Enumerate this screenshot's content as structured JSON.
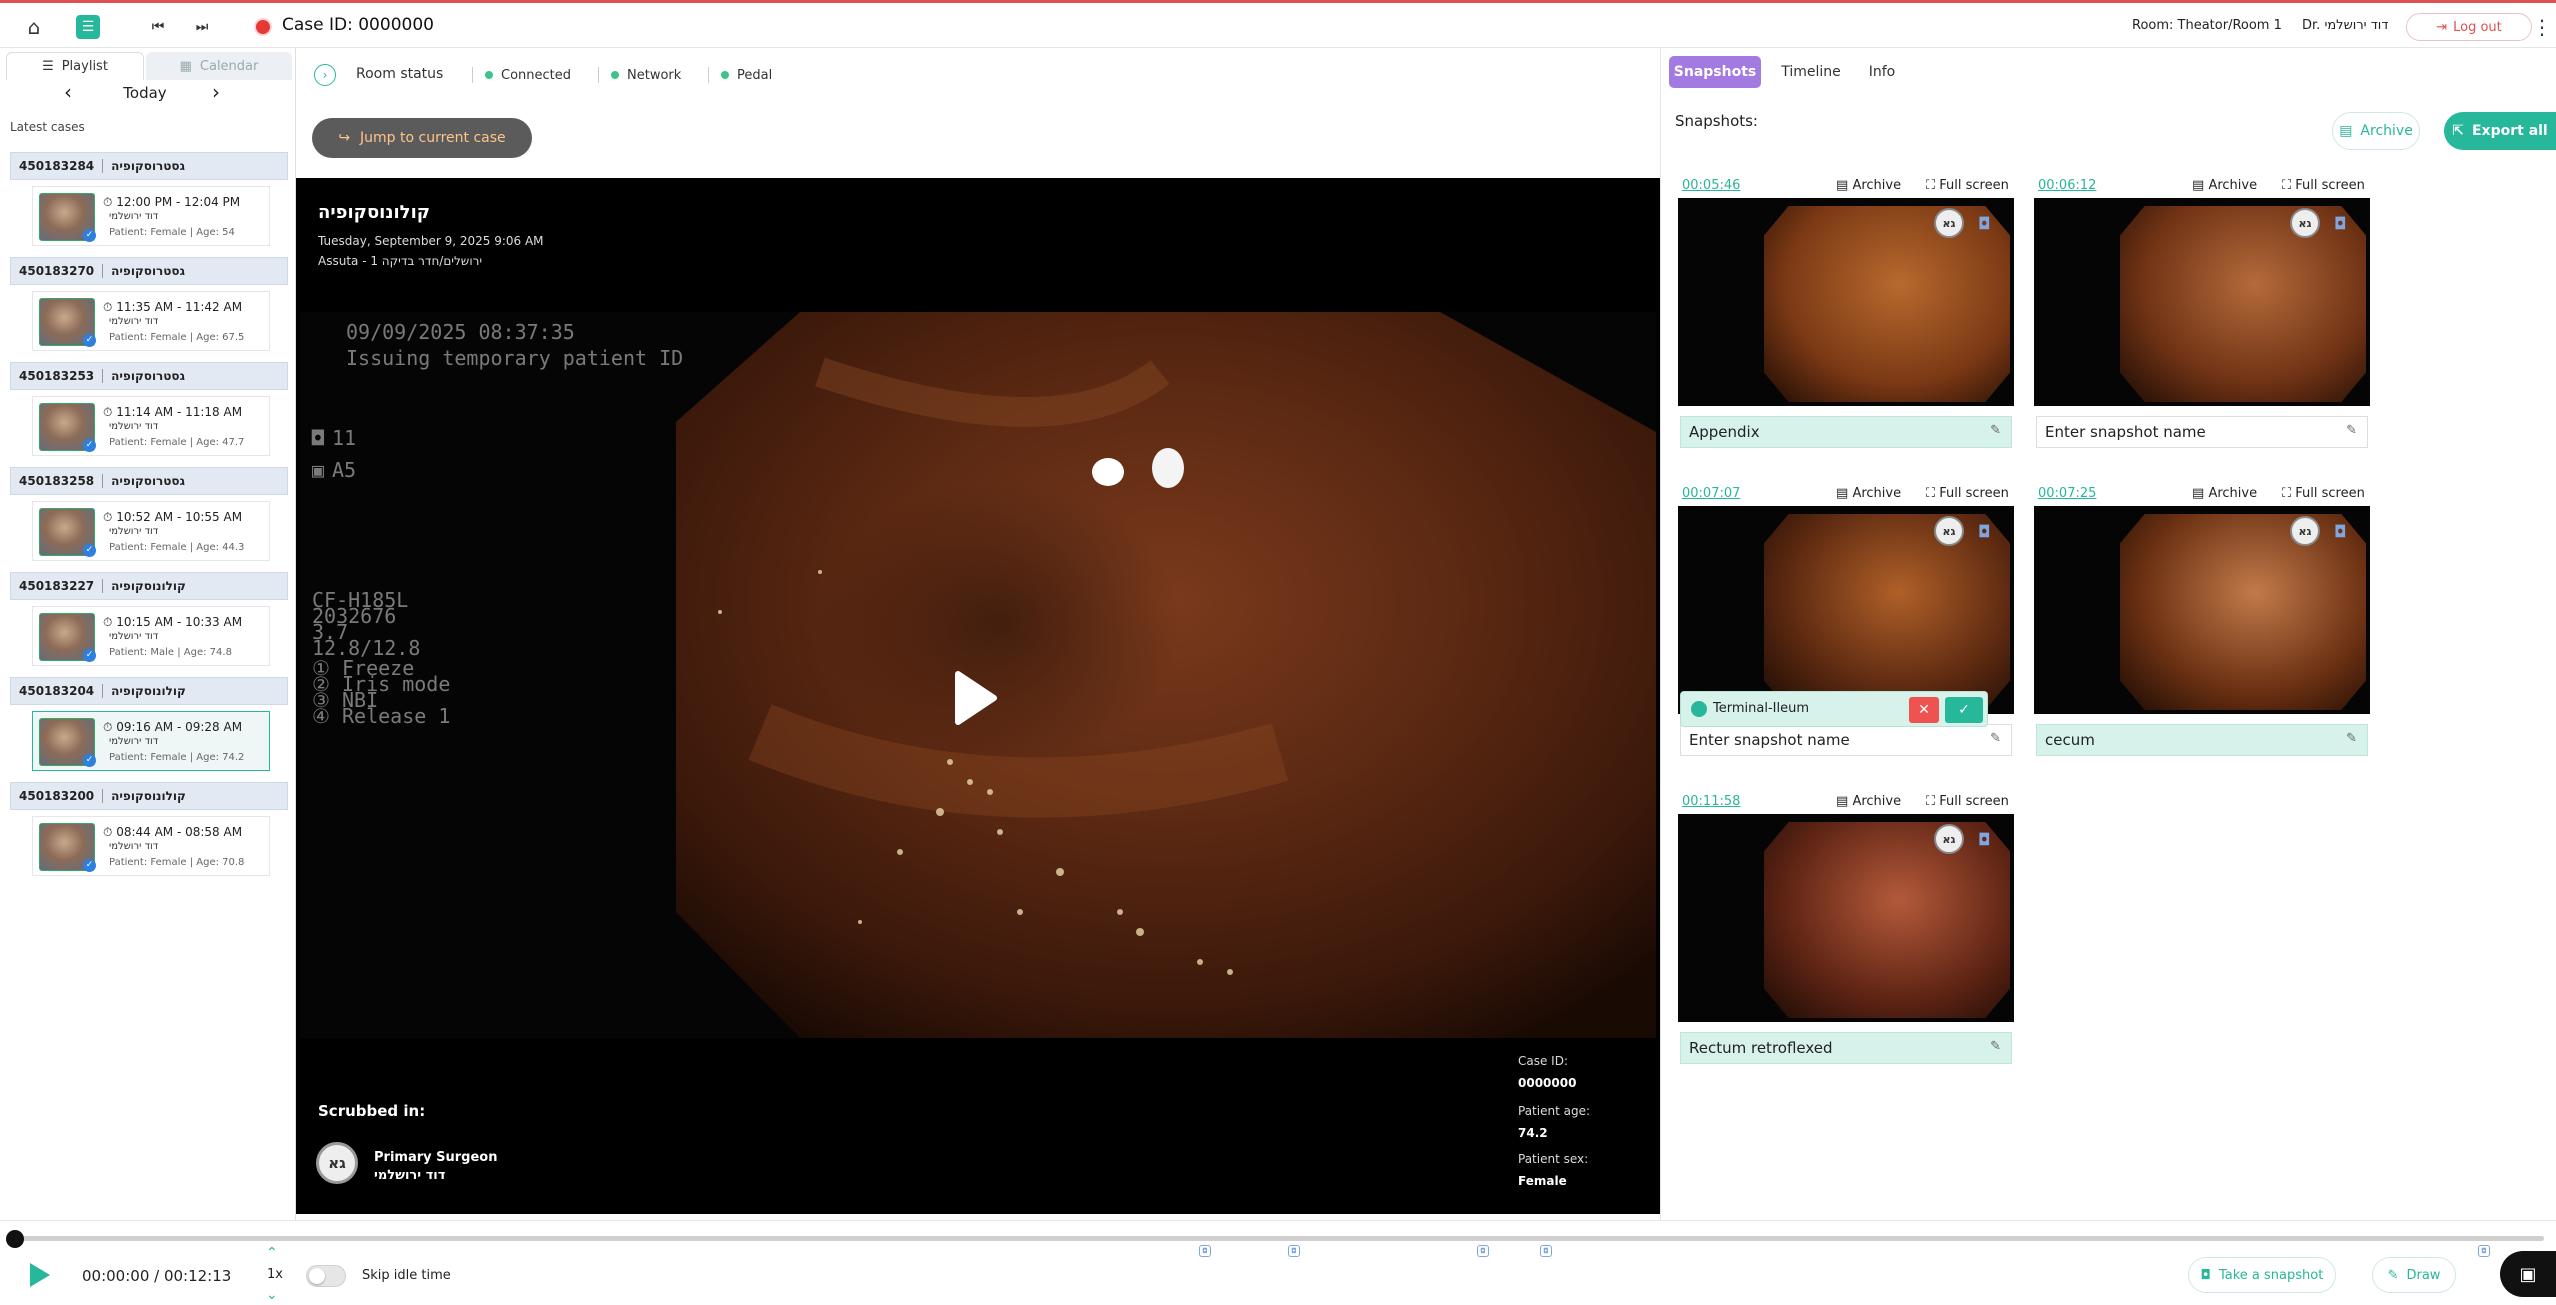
{
  "topbar": {
    "case_title": "Case ID: 0000000",
    "room": "Room: Theator/Room 1",
    "user": "Dr. דוד ירושלמי",
    "logout_label": "Log out"
  },
  "sidebar": {
    "tabs": [
      "Playlist",
      "Calendar"
    ],
    "day": "Today",
    "latest_label": "Latest cases",
    "cases": [
      {
        "id": "450183284",
        "procedure": "גסטרוסקופיה",
        "time": "12:00 PM - 12:04 PM",
        "doctor": "דוד ירושלמי",
        "patient": "Patient: Female | Age: 54"
      },
      {
        "id": "450183270",
        "procedure": "גסטרוסקופיה",
        "time": "11:35 AM - 11:42 AM",
        "doctor": "דוד ירושלמי",
        "patient": "Patient: Female | Age: 67.5"
      },
      {
        "id": "450183253",
        "procedure": "גסטרוסקופיה",
        "time": "11:14 AM - 11:18 AM",
        "doctor": "דוד ירושלמי",
        "patient": "Patient: Female | Age: 47.7"
      },
      {
        "id": "450183258",
        "procedure": "גסטרוסקופיה",
        "time": "10:52 AM - 10:55 AM",
        "doctor": "דוד ירושלמי",
        "patient": "Patient: Female | Age: 44.3"
      },
      {
        "id": "450183227",
        "procedure": "קולונוסקופיה",
        "time": "10:15 AM - 10:33 AM",
        "doctor": "דוד ירושלמי",
        "patient": "Patient: Male | Age: 74.8"
      },
      {
        "id": "450183204",
        "procedure": "קולונוסקופיה",
        "time": "09:16 AM - 09:28 AM",
        "doctor": "דוד ירושלמי",
        "patient": "Patient: Female | Age: 74.2"
      },
      {
        "id": "450183200",
        "procedure": "קולונוסקופיה",
        "time": "08:44 AM - 08:58 AM",
        "doctor": "דוד ירושלמי",
        "patient": "Patient: Female | Age: 70.8"
      }
    ]
  },
  "room_status": {
    "label": "Room status",
    "items": [
      "Connected",
      "Network",
      "Pedal"
    ]
  },
  "jump_label": "Jump to current case",
  "video": {
    "procedure": "קולונוסקופיה",
    "date": "Tuesday, September 9, 2025 9:06 AM",
    "location": "Assuta - 1 ירושלים/חדר בדיקה",
    "overlay_date": "09/09/2025  08:37:35",
    "overlay_msg": "Issuing temporary patient ID",
    "overlay_count": "11",
    "overlay_a": "A5",
    "overlay_scope": [
      "CF-H185L",
      "2032676",
      "3.7",
      "12.8/12.8"
    ],
    "overlay_modes": [
      "Freeze",
      "Iris mode",
      "NBI",
      "Release 1"
    ],
    "scrubbed_label": "Scrubbed in:",
    "surgeon_initials": "גא",
    "surgeon_role": "Primary Surgeon",
    "surgeon_name": "דוד ירושלמי",
    "case_id_label": "Case ID:",
    "case_id": "0000000",
    "age_label": "Patient age:",
    "age": "74.2",
    "sex_label": "Patient sex:",
    "sex": "Female"
  },
  "right_panel": {
    "tabs": [
      "Snapshots",
      "Timeline",
      "Info"
    ],
    "title": "Snapshots:",
    "archive_all": "Archive",
    "export_all": "Export all",
    "archive_label": "Archive",
    "fullscreen_label": "Full screen",
    "placeholder": "Enter snapshot name",
    "snapshots": [
      {
        "time": "00:05:46",
        "name": "Appendix"
      },
      {
        "time": "00:06:12",
        "name": ""
      },
      {
        "time": "00:07:07",
        "name": ""
      },
      {
        "time": "00:07:25",
        "name": "cecum"
      },
      {
        "time": "00:11:58",
        "name": "Rectum retroflexed"
      }
    ],
    "tag_popup": "Terminal-Ileum"
  },
  "player": {
    "time": "00:00:00 / 00:12:13",
    "speed": "1x",
    "skip_label": "Skip idle time",
    "snapshot_btn": "Take a snapshot",
    "draw_btn": "Draw"
  },
  "colors": {
    "accent": "#27b79a",
    "tab_active": "#a37be0",
    "record": "#e53935"
  }
}
